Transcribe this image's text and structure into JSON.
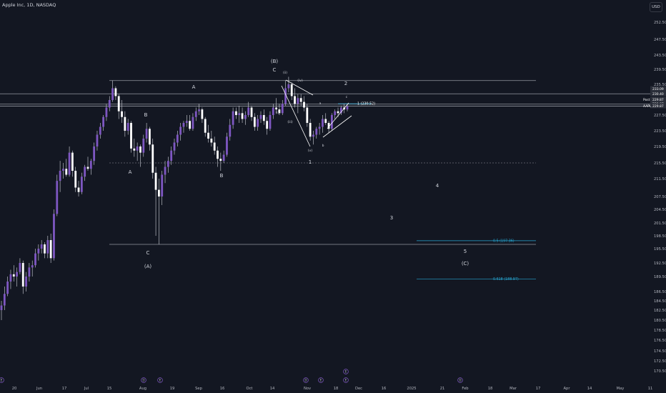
{
  "header": {
    "symbol_title": "Apple Inc, 1D, NASDAQ",
    "currency": "USD"
  },
  "colors": {
    "background": "#131722",
    "candle_body": "#7e57c2",
    "candle_up": "#ffffff",
    "wick": "#d1d4dc",
    "level_line": "#9598a1",
    "fib_line": "#26a6d1",
    "text": "#d1d4dc",
    "axis_text": "#b2b5be"
  },
  "chart_data": {
    "type": "candlestick",
    "title": "Apple Inc, 1D, NASDAQ",
    "xlabel": "",
    "ylabel": "",
    "ylim": [
      168.5,
      254.5
    ],
    "y_ticks": [
      170.5,
      172.5,
      174.5,
      176.5,
      178.5,
      180.5,
      182.5,
      184.5,
      186.5,
      189.5,
      192.5,
      195.5,
      198.5,
      201.5,
      204.5,
      207.5,
      211.5,
      215.5,
      219.5,
      223.5,
      227.5,
      231.5,
      235.5,
      239.5,
      243.5,
      247.5,
      252.5
    ],
    "x_ticks": [
      "20",
      "Jun",
      "17",
      "Jul",
      "15",
      "Aug",
      "19",
      "Sep",
      "16",
      "Oct",
      "14",
      "Nov",
      "18",
      "Dec",
      "16",
      "2025",
      "21",
      "Feb",
      "18",
      "Mar",
      "17",
      "Apr",
      "14",
      "May",
      "11"
    ],
    "price_labels": [
      {
        "label": "",
        "value": "230.40",
        "price": 230.4
      },
      {
        "label": "",
        "value": "233.09",
        "price": 233.09
      },
      {
        "label": "Post",
        "value": "229.87",
        "price": 229.87
      },
      {
        "label": "",
        "value": "229.87",
        "price": 229.87
      },
      {
        "label": "AAPL",
        "value": "229.87",
        "price": 229.87
      }
    ],
    "candles": [
      {
        "o": 182.5,
        "h": 184.5,
        "l": 180.5,
        "c": 183.5
      },
      {
        "o": 183.5,
        "h": 187.5,
        "l": 182.5,
        "c": 186.0
      },
      {
        "o": 186.0,
        "h": 189.5,
        "l": 185.5,
        "c": 188.5
      },
      {
        "o": 188.5,
        "h": 191.0,
        "l": 187.0,
        "c": 190.0
      },
      {
        "o": 190.0,
        "h": 192.0,
        "l": 188.5,
        "c": 189.5
      },
      {
        "o": 189.5,
        "h": 191.5,
        "l": 187.5,
        "c": 190.5
      },
      {
        "o": 190.5,
        "h": 193.5,
        "l": 190.0,
        "c": 192.5
      },
      {
        "o": 192.5,
        "h": 193.0,
        "l": 186.0,
        "c": 187.5
      },
      {
        "o": 187.5,
        "h": 190.5,
        "l": 186.5,
        "c": 189.5
      },
      {
        "o": 189.5,
        "h": 192.5,
        "l": 188.5,
        "c": 191.5
      },
      {
        "o": 191.5,
        "h": 193.0,
        "l": 189.5,
        "c": 192.0
      },
      {
        "o": 192.0,
        "h": 195.5,
        "l": 191.5,
        "c": 194.5
      },
      {
        "o": 194.5,
        "h": 196.5,
        "l": 193.0,
        "c": 195.5
      },
      {
        "o": 195.5,
        "h": 197.5,
        "l": 194.5,
        "c": 196.5
      },
      {
        "o": 196.5,
        "h": 197.0,
        "l": 193.5,
        "c": 194.5
      },
      {
        "o": 194.5,
        "h": 198.5,
        "l": 193.5,
        "c": 197.5
      },
      {
        "o": 197.5,
        "h": 199.0,
        "l": 192.5,
        "c": 193.5
      },
      {
        "o": 193.5,
        "h": 204.5,
        "l": 193.0,
        "c": 203.5
      },
      {
        "o": 203.5,
        "h": 212.5,
        "l": 203.0,
        "c": 211.0
      },
      {
        "o": 211.0,
        "h": 216.0,
        "l": 208.5,
        "c": 213.5
      },
      {
        "o": 213.5,
        "h": 215.5,
        "l": 211.5,
        "c": 214.0
      },
      {
        "o": 214.0,
        "h": 216.5,
        "l": 212.0,
        "c": 212.5
      },
      {
        "o": 212.5,
        "h": 219.5,
        "l": 212.0,
        "c": 218.0
      },
      {
        "o": 218.0,
        "h": 218.5,
        "l": 212.0,
        "c": 213.5
      },
      {
        "o": 213.5,
        "h": 214.5,
        "l": 208.5,
        "c": 209.5
      },
      {
        "o": 209.5,
        "h": 211.0,
        "l": 207.5,
        "c": 208.5
      },
      {
        "o": 208.5,
        "h": 213.0,
        "l": 208.0,
        "c": 212.0
      },
      {
        "o": 212.0,
        "h": 215.0,
        "l": 211.0,
        "c": 214.5
      },
      {
        "o": 214.5,
        "h": 217.0,
        "l": 213.5,
        "c": 214.0
      },
      {
        "o": 214.0,
        "h": 216.5,
        "l": 212.5,
        "c": 216.0
      },
      {
        "o": 216.0,
        "h": 220.5,
        "l": 215.0,
        "c": 219.5
      },
      {
        "o": 219.5,
        "h": 223.5,
        "l": 218.5,
        "c": 222.5
      },
      {
        "o": 222.5,
        "h": 225.5,
        "l": 221.5,
        "c": 224.5
      },
      {
        "o": 224.5,
        "h": 227.5,
        "l": 223.5,
        "c": 227.0
      },
      {
        "o": 227.0,
        "h": 230.5,
        "l": 226.0,
        "c": 229.5
      },
      {
        "o": 229.5,
        "h": 232.5,
        "l": 228.5,
        "c": 231.5
      },
      {
        "o": 231.5,
        "h": 236.5,
        "l": 231.0,
        "c": 234.5
      },
      {
        "o": 234.5,
        "h": 235.0,
        "l": 231.5,
        "c": 232.5
      },
      {
        "o": 232.5,
        "h": 233.0,
        "l": 226.5,
        "c": 228.5
      },
      {
        "o": 228.5,
        "h": 231.5,
        "l": 225.5,
        "c": 227.0
      },
      {
        "o": 227.0,
        "h": 228.5,
        "l": 222.0,
        "c": 223.5
      },
      {
        "o": 223.5,
        "h": 226.5,
        "l": 222.5,
        "c": 225.5
      },
      {
        "o": 225.5,
        "h": 226.0,
        "l": 218.0,
        "c": 219.0
      },
      {
        "o": 219.0,
        "h": 221.5,
        "l": 217.0,
        "c": 218.5
      },
      {
        "o": 218.5,
        "h": 220.5,
        "l": 216.0,
        "c": 219.5
      },
      {
        "o": 219.5,
        "h": 220.0,
        "l": 214.5,
        "c": 218.0
      },
      {
        "o": 218.0,
        "h": 222.5,
        "l": 217.0,
        "c": 221.5
      },
      {
        "o": 221.5,
        "h": 225.5,
        "l": 220.5,
        "c": 224.0
      },
      {
        "o": 224.0,
        "h": 224.5,
        "l": 218.5,
        "c": 220.0
      },
      {
        "o": 220.0,
        "h": 221.5,
        "l": 211.5,
        "c": 213.0
      },
      {
        "o": 213.0,
        "h": 214.5,
        "l": 198.5,
        "c": 209.0
      },
      {
        "o": 209.0,
        "h": 211.5,
        "l": 196.5,
        "c": 207.5
      },
      {
        "o": 207.5,
        "h": 213.5,
        "l": 205.5,
        "c": 212.5
      },
      {
        "o": 212.5,
        "h": 216.0,
        "l": 210.5,
        "c": 214.5
      },
      {
        "o": 214.5,
        "h": 217.0,
        "l": 213.0,
        "c": 216.0
      },
      {
        "o": 216.0,
        "h": 219.5,
        "l": 215.0,
        "c": 218.5
      },
      {
        "o": 218.5,
        "h": 221.5,
        "l": 217.5,
        "c": 220.5
      },
      {
        "o": 220.5,
        "h": 223.5,
        "l": 219.5,
        "c": 222.5
      },
      {
        "o": 222.5,
        "h": 225.5,
        "l": 221.0,
        "c": 224.5
      },
      {
        "o": 224.5,
        "h": 226.0,
        "l": 223.0,
        "c": 225.5
      },
      {
        "o": 225.5,
        "h": 227.5,
        "l": 224.5,
        "c": 226.0
      },
      {
        "o": 226.0,
        "h": 227.5,
        "l": 223.5,
        "c": 224.0
      },
      {
        "o": 224.0,
        "h": 228.0,
        "l": 223.5,
        "c": 227.0
      },
      {
        "o": 227.0,
        "h": 229.5,
        "l": 226.0,
        "c": 228.5
      },
      {
        "o": 228.5,
        "h": 230.5,
        "l": 227.5,
        "c": 229.0
      },
      {
        "o": 229.0,
        "h": 229.5,
        "l": 225.5,
        "c": 226.5
      },
      {
        "o": 226.5,
        "h": 227.0,
        "l": 222.0,
        "c": 223.0
      },
      {
        "o": 223.0,
        "h": 225.0,
        "l": 220.5,
        "c": 221.5
      },
      {
        "o": 221.5,
        "h": 223.5,
        "l": 219.5,
        "c": 220.5
      },
      {
        "o": 220.5,
        "h": 222.0,
        "l": 217.5,
        "c": 218.5
      },
      {
        "o": 218.5,
        "h": 219.5,
        "l": 214.5,
        "c": 216.5
      },
      {
        "o": 216.5,
        "h": 218.0,
        "l": 213.5,
        "c": 216.0
      },
      {
        "o": 216.0,
        "h": 218.5,
        "l": 215.5,
        "c": 217.5
      },
      {
        "o": 217.5,
        "h": 223.0,
        "l": 217.0,
        "c": 222.0
      },
      {
        "o": 222.0,
        "h": 226.5,
        "l": 221.0,
        "c": 225.0
      },
      {
        "o": 225.0,
        "h": 229.5,
        "l": 224.0,
        "c": 228.5
      },
      {
        "o": 228.5,
        "h": 229.5,
        "l": 226.5,
        "c": 227.5
      },
      {
        "o": 227.5,
        "h": 230.0,
        "l": 225.5,
        "c": 228.0
      },
      {
        "o": 228.0,
        "h": 229.5,
        "l": 225.5,
        "c": 226.5
      },
      {
        "o": 226.5,
        "h": 228.5,
        "l": 225.0,
        "c": 227.5
      },
      {
        "o": 227.5,
        "h": 231.0,
        "l": 227.0,
        "c": 229.5
      },
      {
        "o": 229.5,
        "h": 230.0,
        "l": 226.0,
        "c": 227.0
      },
      {
        "o": 227.0,
        "h": 228.0,
        "l": 223.5,
        "c": 224.5
      },
      {
        "o": 224.5,
        "h": 227.5,
        "l": 223.5,
        "c": 226.5
      },
      {
        "o": 226.5,
        "h": 228.5,
        "l": 225.5,
        "c": 227.5
      },
      {
        "o": 227.5,
        "h": 229.0,
        "l": 225.0,
        "c": 226.0
      },
      {
        "o": 226.0,
        "h": 227.0,
        "l": 222.5,
        "c": 224.0
      },
      {
        "o": 224.0,
        "h": 228.5,
        "l": 223.5,
        "c": 227.5
      },
      {
        "o": 227.5,
        "h": 230.5,
        "l": 226.5,
        "c": 229.5
      },
      {
        "o": 229.5,
        "h": 232.0,
        "l": 228.0,
        "c": 229.0
      },
      {
        "o": 229.0,
        "h": 230.5,
        "l": 227.5,
        "c": 228.0
      },
      {
        "o": 228.0,
        "h": 231.5,
        "l": 227.5,
        "c": 230.5
      },
      {
        "o": 230.5,
        "h": 236.5,
        "l": 230.0,
        "c": 234.5
      },
      {
        "o": 234.5,
        "h": 237.5,
        "l": 233.5,
        "c": 235.5
      },
      {
        "o": 235.5,
        "h": 236.0,
        "l": 231.5,
        "c": 232.5
      },
      {
        "o": 232.5,
        "h": 234.5,
        "l": 229.5,
        "c": 230.5
      },
      {
        "o": 230.5,
        "h": 233.0,
        "l": 228.0,
        "c": 232.0
      },
      {
        "o": 232.0,
        "h": 233.0,
        "l": 230.0,
        "c": 231.0
      },
      {
        "o": 231.0,
        "h": 232.5,
        "l": 228.5,
        "c": 229.5
      },
      {
        "o": 229.5,
        "h": 230.5,
        "l": 224.5,
        "c": 225.5
      },
      {
        "o": 225.5,
        "h": 226.5,
        "l": 221.0,
        "c": 222.0
      },
      {
        "o": 222.0,
        "h": 223.5,
        "l": 220.0,
        "c": 222.5
      },
      {
        "o": 222.5,
        "h": 224.5,
        "l": 221.5,
        "c": 224.0
      },
      {
        "o": 224.0,
        "h": 225.5,
        "l": 222.5,
        "c": 224.5
      },
      {
        "o": 224.5,
        "h": 227.5,
        "l": 223.0,
        "c": 226.5
      },
      {
        "o": 226.5,
        "h": 228.0,
        "l": 225.0,
        "c": 225.5
      },
      {
        "o": 225.5,
        "h": 226.0,
        "l": 223.0,
        "c": 224.0
      },
      {
        "o": 224.0,
        "h": 228.0,
        "l": 223.5,
        "c": 227.5
      },
      {
        "o": 227.5,
        "h": 229.0,
        "l": 226.5,
        "c": 228.5
      },
      {
        "o": 228.5,
        "h": 229.5,
        "l": 227.0,
        "c": 228.0
      },
      {
        "o": 228.0,
        "h": 230.0,
        "l": 227.5,
        "c": 229.5
      },
      {
        "o": 229.5,
        "h": 230.5,
        "l": 228.0,
        "c": 229.0
      },
      {
        "o": 229.0,
        "h": 230.5,
        "l": 228.5,
        "c": 229.87
      }
    ],
    "horizontal_levels": [
      {
        "name": "upper-resistance",
        "price": 236.5
      },
      {
        "name": "level-233",
        "price": 233.09
      },
      {
        "name": "level-230",
        "price": 230.4
      },
      {
        "name": "level-229",
        "price": 229.87
      },
      {
        "name": "lower-support",
        "price": 196.5
      }
    ],
    "dashed_levels": [
      {
        "name": "wave-1-level",
        "price": 215.5
      }
    ],
    "fib_levels": [
      {
        "label": "1 (230.52)",
        "price": 230.52
      },
      {
        "label": "0.5 (197.36)",
        "price": 197.36
      },
      {
        "label": "0.618 (188.97)",
        "price": 188.97
      }
    ],
    "annotations": [
      {
        "text": "(B)",
        "kind": "major"
      },
      {
        "text": "C",
        "kind": "wave"
      },
      {
        "text": "A",
        "kind": "wave"
      },
      {
        "text": "A",
        "kind": "wave"
      },
      {
        "text": "B",
        "kind": "wave"
      },
      {
        "text": "B",
        "kind": "wave"
      },
      {
        "text": "C",
        "kind": "wave"
      },
      {
        "text": "(A)",
        "kind": "major"
      },
      {
        "text": "2",
        "kind": "wave"
      },
      {
        "text": "1",
        "kind": "wave"
      },
      {
        "text": "3",
        "kind": "wave"
      },
      {
        "text": "4",
        "kind": "wave"
      },
      {
        "text": "5",
        "kind": "wave"
      },
      {
        "text": "(C)",
        "kind": "major"
      },
      {
        "text": "(i)",
        "kind": "minor"
      },
      {
        "text": "(ii)",
        "kind": "minor"
      },
      {
        "text": "(iii)",
        "kind": "minor"
      },
      {
        "text": "(iv)",
        "kind": "minor"
      },
      {
        "text": "(v)",
        "kind": "minor"
      },
      {
        "text": "a",
        "kind": "minor"
      },
      {
        "text": "b",
        "kind": "minor"
      },
      {
        "text": "c",
        "kind": "minor"
      }
    ],
    "event_markers": [
      "E",
      "D",
      "E",
      "D",
      "E",
      "E",
      "E",
      "D"
    ]
  }
}
